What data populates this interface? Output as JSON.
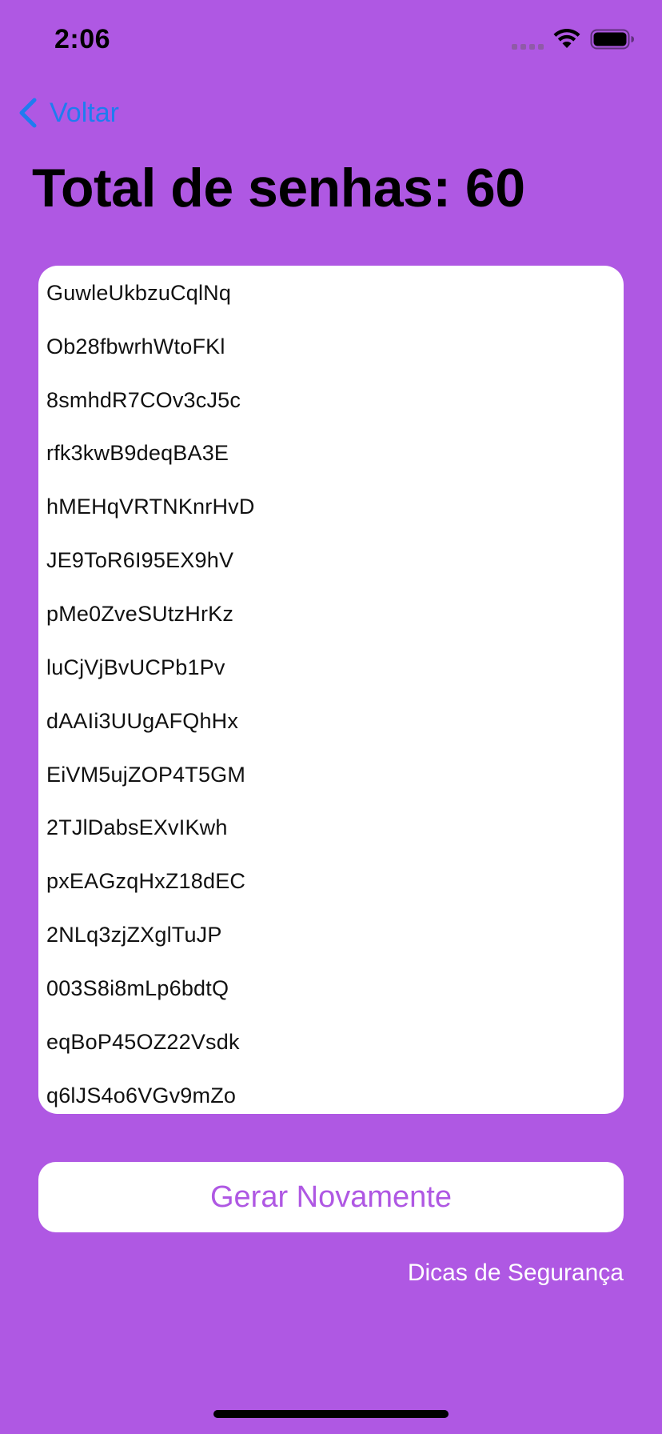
{
  "status_bar": {
    "time": "2:06"
  },
  "nav": {
    "back_label": "Voltar"
  },
  "header": {
    "title": "Total de senhas: 60"
  },
  "passwords": [
    "GuwleUkbzuCqlNq",
    "Ob28fbwrhWtoFKl",
    "8smhdR7COv3cJ5c",
    "rfk3kwB9deqBA3E",
    "hMEHqVRTNKnrHvD",
    "JE9ToR6I95EX9hV",
    "pMe0ZveSUtzHrKz",
    "luCjVjBvUCPb1Pv",
    "dAAIi3UUgAFQhHx",
    "EiVM5ujZOP4T5GM",
    "2TJlDabsEXvIKwh",
    "pxEAGzqHxZ18dEC",
    "2NLq3zjZXglTuJP",
    "003S8i8mLp6bdtQ",
    "eqBoP45OZ22Vsdk",
    "q6lJS4o6VGv9mZo"
  ],
  "actions": {
    "regenerate_label": "Gerar Novamente",
    "tips_label": "Dicas de Segurança"
  },
  "colors": {
    "background": "#AF58E3",
    "accent": "#AF58E3",
    "link": "#1F7CF0"
  }
}
